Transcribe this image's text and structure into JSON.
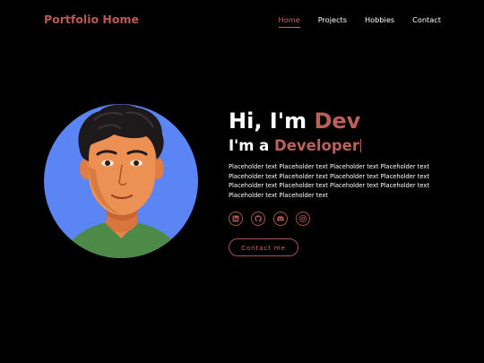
{
  "navbar": {
    "brand": "Portfolio Home",
    "links": [
      {
        "label": "Home",
        "active": true
      },
      {
        "label": "Projects"
      },
      {
        "label": "Hobbies"
      },
      {
        "label": "Contact"
      }
    ]
  },
  "hero": {
    "greeting": "Hi, I'm ",
    "name": "Dev",
    "role_prefix": "I'm a ",
    "role": "Developer",
    "description": "Placeholder text Placeholder text Placeholder text Placeholder text Placeholder text Placeholder text Placeholder text Placeholder text Placeholder text Placeholder text Placeholder text Placeholder text Placeholder text Placeholder text",
    "contact_button": "Contact me",
    "socials": [
      "linkedin-icon",
      "github-icon",
      "discord-icon",
      "instagram-icon"
    ]
  },
  "colors": {
    "background": "#000000",
    "accent": "#b9605b",
    "avatar_bg": "#5b84f4"
  }
}
